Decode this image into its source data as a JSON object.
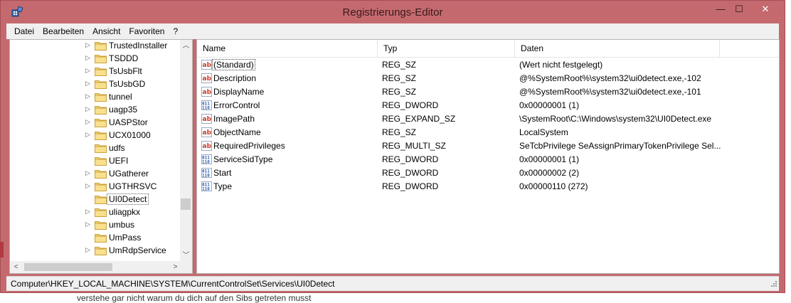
{
  "window": {
    "title": "Registrierungs-Editor",
    "minimize_symbol": "—",
    "maximize_symbol": "☐",
    "close_symbol": "✕",
    "frame_color": "#c46a6f"
  },
  "menu": [
    "Datei",
    "Bearbeiten",
    "Ansicht",
    "Favoriten",
    "?"
  ],
  "tree": {
    "items": [
      {
        "label": "TrustedInstaller",
        "has_children": true
      },
      {
        "label": "TSDDD",
        "has_children": true
      },
      {
        "label": "TsUsbFlt",
        "has_children": true
      },
      {
        "label": "TsUsbGD",
        "has_children": true
      },
      {
        "label": "tunnel",
        "has_children": true
      },
      {
        "label": "uagp35",
        "has_children": true
      },
      {
        "label": "UASPStor",
        "has_children": true
      },
      {
        "label": "UCX01000",
        "has_children": true
      },
      {
        "label": "udfs",
        "has_children": false
      },
      {
        "label": "UEFI",
        "has_children": false
      },
      {
        "label": "UGatherer",
        "has_children": true
      },
      {
        "label": "UGTHRSVC",
        "has_children": true
      },
      {
        "label": "UI0Detect",
        "has_children": false,
        "selected": true
      },
      {
        "label": "uliagpkx",
        "has_children": true
      },
      {
        "label": "umbus",
        "has_children": true
      },
      {
        "label": "UmPass",
        "has_children": false
      },
      {
        "label": "UmRdpService",
        "has_children": true
      }
    ]
  },
  "list": {
    "columns": [
      "Name",
      "Typ",
      "Daten"
    ],
    "rows": [
      {
        "name": "(Standard)",
        "type": "REG_SZ",
        "data": "(Wert nicht festgelegt)",
        "icon": "string-value-icon",
        "selected": true
      },
      {
        "name": "Description",
        "type": "REG_SZ",
        "data": "@%SystemRoot%\\system32\\ui0detect.exe,-102",
        "icon": "string-value-icon"
      },
      {
        "name": "DisplayName",
        "type": "REG_SZ",
        "data": "@%SystemRoot%\\system32\\ui0detect.exe,-101",
        "icon": "string-value-icon"
      },
      {
        "name": "ErrorControl",
        "type": "REG_DWORD",
        "data": "0x00000001 (1)",
        "icon": "binary-value-icon"
      },
      {
        "name": "ImagePath",
        "type": "REG_EXPAND_SZ",
        "data": "\\SystemRoot\\C:\\Windows\\system32\\UI0Detect.exe",
        "icon": "string-value-icon"
      },
      {
        "name": "ObjectName",
        "type": "REG_SZ",
        "data": "LocalSystem",
        "icon": "string-value-icon"
      },
      {
        "name": "RequiredPrivileges",
        "type": "REG_MULTI_SZ",
        "data": "SeTcbPrivilege SeAssignPrimaryTokenPrivilege Sel...",
        "icon": "string-value-icon"
      },
      {
        "name": "ServiceSidType",
        "type": "REG_DWORD",
        "data": "0x00000001 (1)",
        "icon": "binary-value-icon"
      },
      {
        "name": "Start",
        "type": "REG_DWORD",
        "data": "0x00000002 (2)",
        "icon": "binary-value-icon"
      },
      {
        "name": "Type",
        "type": "REG_DWORD",
        "data": "0x00000110 (272)",
        "icon": "binary-value-icon"
      }
    ]
  },
  "status": {
    "path": "Computer\\HKEY_LOCAL_MACHINE\\SYSTEM\\CurrentControlSet\\Services\\UI0Detect"
  },
  "background_text": "verstehe gar nicht warum du dich auf den Sibs getreten musst"
}
